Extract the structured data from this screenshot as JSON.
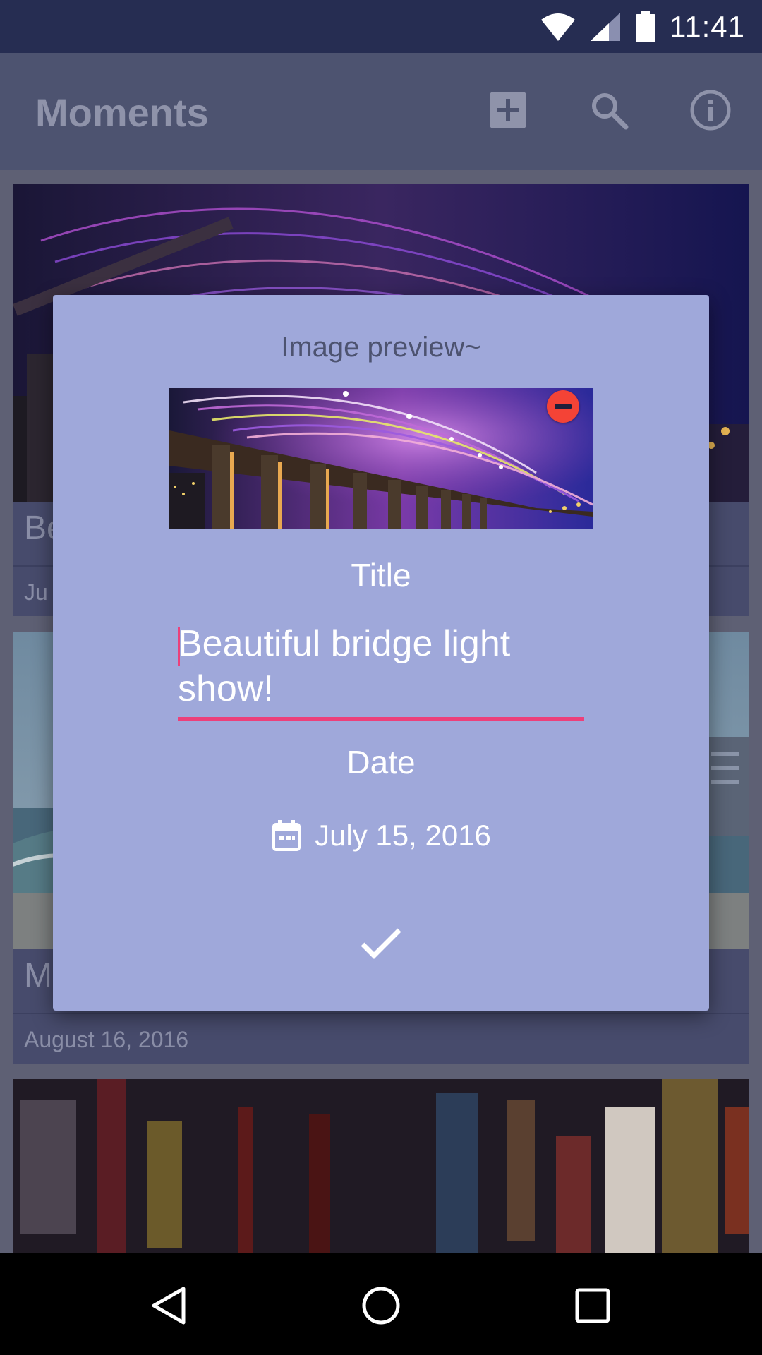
{
  "status_bar": {
    "time": "11:41"
  },
  "app_bar": {
    "title": "Moments",
    "actions": [
      "add-box-icon",
      "search-icon",
      "info-icon"
    ]
  },
  "cards": [
    {
      "title": "Beautiful bridge light show!",
      "date": "July 15, 2016",
      "visible_title": "Be",
      "visible_date": "Ju"
    },
    {
      "title": "",
      "date": "August 16, 2016",
      "visible_title": "M"
    },
    {
      "title": "",
      "date": ""
    }
  ],
  "dialog": {
    "heading": "Image preview~",
    "title_label": "Title",
    "title_value": "Beautiful bridge light show!",
    "date_label": "Date",
    "date_value": "July 15, 2016",
    "remove_icon": "remove-circle-icon",
    "date_icon": "calendar-icon",
    "confirm_icon": "check-icon"
  },
  "nav_bar": [
    "back-icon",
    "home-icon",
    "recents-icon"
  ],
  "colors": {
    "status_bar": "#262d52",
    "dialog_bg": "#9fa8da",
    "accent": "#ec407a",
    "remove": "#f44336"
  }
}
